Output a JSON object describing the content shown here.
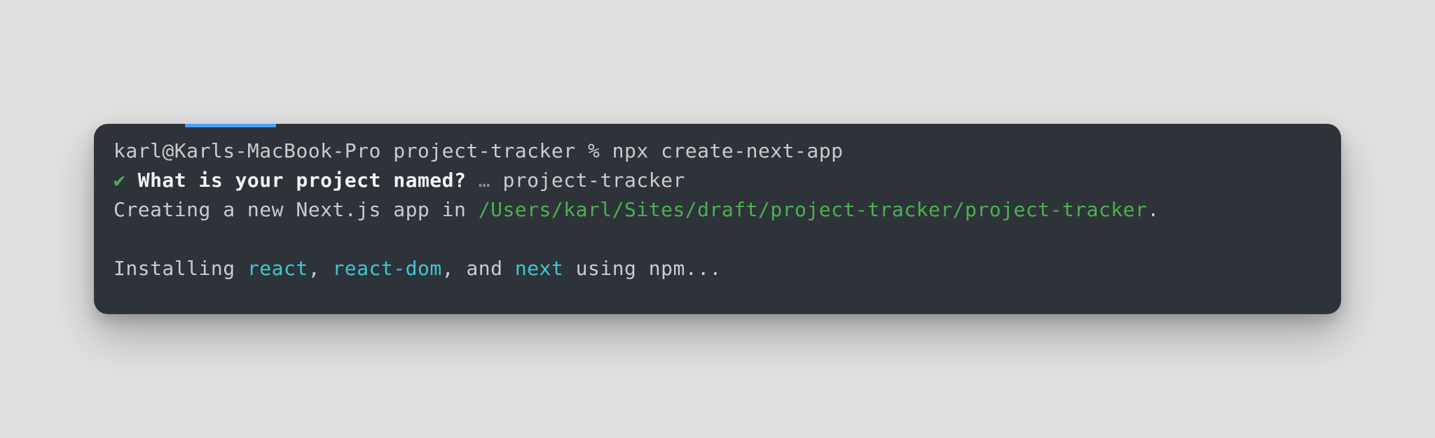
{
  "terminal": {
    "prompt_text": "karl@Karls-MacBook-Pro project-tracker % npx create-next-app",
    "line2": {
      "checkmark": "✔",
      "question": "What is your project named?",
      "ellipsis": "…",
      "answer": "project-tracker"
    },
    "line3": {
      "prefix": "Creating a new Next.js app in ",
      "path": "/Users/karl/Sites/draft/project-tracker/project-tracker",
      "suffix": "."
    },
    "line5": {
      "w1": "Installing ",
      "pkg1": "react",
      "c1": ", ",
      "pkg2": "react-dom",
      "c2": ", and ",
      "pkg3": "next",
      "w2": " using npm..."
    }
  }
}
